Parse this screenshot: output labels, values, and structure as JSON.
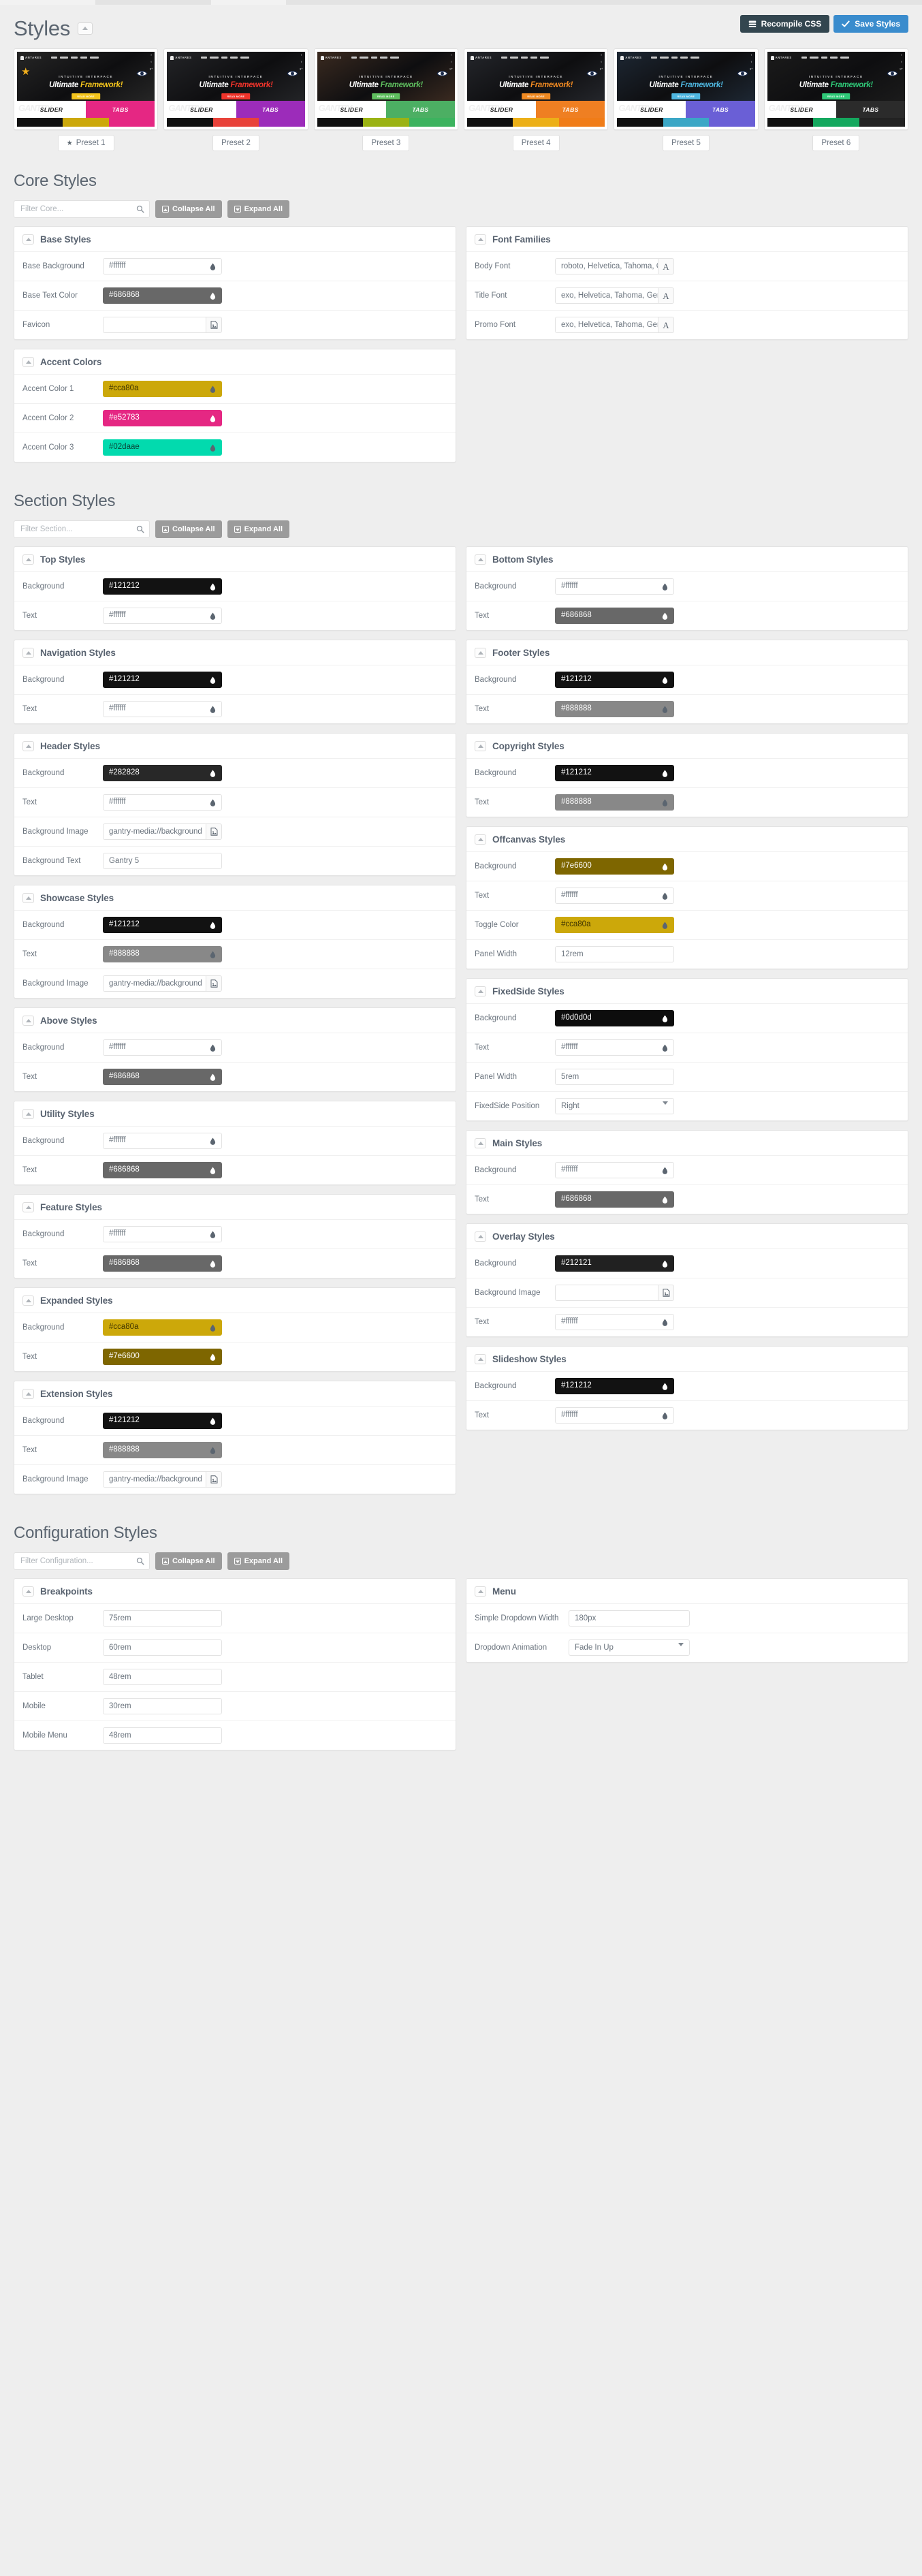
{
  "header": {
    "title": "Styles",
    "collapse_icon": "chevron-up-icon",
    "buttons": [
      {
        "label": "Recompile CSS",
        "icon": "server-icon",
        "color": "#33464f"
      },
      {
        "label": "Save Styles",
        "icon": "check-icon",
        "color": "#3a8ccd"
      }
    ]
  },
  "presets": {
    "thumb_brand": "ANTARES",
    "thumb_nav": [
      "HOME",
      "FEATURES",
      "PAGES",
      "STYLES",
      "DOWNLOAD"
    ],
    "thumb_subtitle": "INTUITIVE INTERFACE",
    "thumb_hero_1": "Ultimate ",
    "thumb_hero_2": "Framework!",
    "thumb_cta": "READ MORE",
    "band_slider": "SLIDER",
    "band_tabs": "TABS",
    "band_ghost": "GANTRY",
    "items": [
      {
        "label": "Preset 1",
        "active": true,
        "accent": "#ddb304",
        "hero_accent": "#f3c41c",
        "tabs_bg": "#e52783",
        "hero_bg": "#262626",
        "swatches": [
          "#111111",
          "#cca80a",
          "#e52783"
        ],
        "eye_icon": "eye-icon",
        "star_icon": "star-icon"
      },
      {
        "label": "Preset 2",
        "active": false,
        "accent": "#e8423a",
        "hero_accent": "#f0342b",
        "tabs_bg": "#9c2cba",
        "hero_bg": "#232427",
        "swatches": [
          "#111111",
          "#e8423a",
          "#9c2cba"
        ],
        "eye_icon": "eye-icon"
      },
      {
        "label": "Preset 3",
        "active": false,
        "accent": "#6fb650",
        "hero_accent": "#5fbf5f",
        "tabs_bg": "#4caf63",
        "hero_bg": "#3a2a20",
        "swatches": [
          "#111111",
          "#9bb313",
          "#3cb35e"
        ],
        "eye_icon": "eye-icon"
      },
      {
        "label": "Preset 4",
        "active": false,
        "accent": "#ef7f22",
        "hero_accent": "#f08a22",
        "tabs_bg": "#ef7f22",
        "hero_bg": "#24262b",
        "swatches": [
          "#111111",
          "#ecb018",
          "#f07c18"
        ],
        "eye_icon": "eye-icon"
      },
      {
        "label": "Preset 5",
        "active": false,
        "accent": "#47a9d0",
        "hero_accent": "#4fb7e0",
        "tabs_bg": "#6a5fd6",
        "hero_bg": "#1d2733",
        "swatches": [
          "#111111",
          "#3ba7c6",
          "#6a5fd6"
        ],
        "eye_icon": "eye-icon"
      },
      {
        "label": "Preset 6",
        "active": false,
        "accent": "#27b36a",
        "hero_accent": "#2fc978",
        "tabs_bg": "#2b2b2b",
        "hero_bg": "#1b1b1b",
        "swatches": [
          "#111111",
          "#14a85e",
          "#222222"
        ],
        "eye_icon": "eye-icon"
      }
    ]
  },
  "core": {
    "title": "Core Styles",
    "filter_placeholder": "Filter Core...",
    "collapse_all": "Collapse All",
    "expand_all": "Expand All",
    "panels_left": [
      {
        "title": "Base Styles",
        "fields": [
          {
            "label": "Base Background",
            "type": "color",
            "value": "#ffffff",
            "bg": "#ffffff",
            "fg": "#6b747e",
            "drop": "#5b6570"
          },
          {
            "label": "Base Text Color",
            "type": "color",
            "value": "#686868",
            "bg": "#686868",
            "fg": "#ffffff",
            "drop": "#ffffff"
          },
          {
            "label": "Favicon",
            "type": "file",
            "value": "",
            "btn_icon": "image-icon"
          }
        ]
      },
      {
        "title": "Accent Colors",
        "fields": [
          {
            "label": "Accent Color 1",
            "type": "color",
            "value": "#cca80a",
            "bg": "#cca80a",
            "fg": "#3d3300",
            "drop": "#5b6570"
          },
          {
            "label": "Accent Color 2",
            "type": "color",
            "value": "#e52783",
            "bg": "#e52783",
            "fg": "#ffffff",
            "drop": "#ffffff"
          },
          {
            "label": "Accent Color 3",
            "type": "color",
            "value": "#02daae",
            "bg": "#02daae",
            "fg": "#0b4437",
            "drop": "#5b6570"
          }
        ]
      }
    ],
    "panels_right": [
      {
        "title": "Font Families",
        "fields": [
          {
            "label": "Body Font",
            "type": "font",
            "value": "roboto, Helvetica, Tahoma, Geneva, Arial, sans-serif",
            "btn_icon": "font-icon"
          },
          {
            "label": "Title Font",
            "type": "font",
            "value": "exo, Helvetica, Tahoma, Geneva, Arial, sans-serif",
            "btn_icon": "font-icon"
          },
          {
            "label": "Promo Font",
            "type": "font",
            "value": "exo, Helvetica, Tahoma, Geneva, Arial, sans-serif",
            "btn_icon": "font-icon"
          }
        ]
      }
    ]
  },
  "section": {
    "title": "Section Styles",
    "filter_placeholder": "Filter Section...",
    "collapse_all": "Collapse All",
    "expand_all": "Expand All",
    "panels_left": [
      {
        "title": "Top Styles",
        "fields": [
          {
            "label": "Background",
            "type": "color",
            "value": "#121212",
            "bg": "#121212",
            "fg": "#ffffff",
            "drop": "#ffffff"
          },
          {
            "label": "Text",
            "type": "color",
            "value": "#ffffff",
            "bg": "#ffffff",
            "fg": "#6b747e",
            "drop": "#5b6570"
          }
        ]
      },
      {
        "title": "Navigation Styles",
        "fields": [
          {
            "label": "Background",
            "type": "color",
            "value": "#121212",
            "bg": "#121212",
            "fg": "#ffffff",
            "drop": "#ffffff"
          },
          {
            "label": "Text",
            "type": "color",
            "value": "#ffffff",
            "bg": "#ffffff",
            "fg": "#6b747e",
            "drop": "#5b6570"
          }
        ]
      },
      {
        "title": "Header Styles",
        "fields": [
          {
            "label": "Background",
            "type": "color",
            "value": "#282828",
            "bg": "#282828",
            "fg": "#ffffff",
            "drop": "#ffffff"
          },
          {
            "label": "Text",
            "type": "color",
            "value": "#ffffff",
            "bg": "#ffffff",
            "fg": "#6b747e",
            "drop": "#5b6570"
          },
          {
            "label": "Background Image",
            "type": "file",
            "value": "gantry-media://background",
            "btn_icon": "image-icon"
          },
          {
            "label": "Background Text",
            "type": "text",
            "value": "Gantry 5"
          }
        ]
      },
      {
        "title": "Showcase Styles",
        "fields": [
          {
            "label": "Background",
            "type": "color",
            "value": "#121212",
            "bg": "#121212",
            "fg": "#ffffff",
            "drop": "#ffffff"
          },
          {
            "label": "Text",
            "type": "color",
            "value": "#888888",
            "bg": "#888888",
            "fg": "#ffffff",
            "drop": "#5b6570"
          },
          {
            "label": "Background Image",
            "type": "file",
            "value": "gantry-media://background",
            "btn_icon": "image-icon"
          }
        ]
      },
      {
        "title": "Above Styles",
        "fields": [
          {
            "label": "Background",
            "type": "color",
            "value": "#ffffff",
            "bg": "#ffffff",
            "fg": "#6b747e",
            "drop": "#5b6570"
          },
          {
            "label": "Text",
            "type": "color",
            "value": "#686868",
            "bg": "#686868",
            "fg": "#ffffff",
            "drop": "#ffffff"
          }
        ]
      },
      {
        "title": "Utility Styles",
        "fields": [
          {
            "label": "Background",
            "type": "color",
            "value": "#ffffff",
            "bg": "#ffffff",
            "fg": "#6b747e",
            "drop": "#5b6570"
          },
          {
            "label": "Text",
            "type": "color",
            "value": "#686868",
            "bg": "#686868",
            "fg": "#ffffff",
            "drop": "#ffffff"
          }
        ]
      },
      {
        "title": "Feature Styles",
        "fields": [
          {
            "label": "Background",
            "type": "color",
            "value": "#ffffff",
            "bg": "#ffffff",
            "fg": "#6b747e",
            "drop": "#5b6570"
          },
          {
            "label": "Text",
            "type": "color",
            "value": "#686868",
            "bg": "#686868",
            "fg": "#ffffff",
            "drop": "#ffffff"
          }
        ]
      },
      {
        "title": "Expanded Styles",
        "fields": [
          {
            "label": "Background",
            "type": "color",
            "value": "#cca80a",
            "bg": "#cca80a",
            "fg": "#3d3300",
            "drop": "#5b6570"
          },
          {
            "label": "Text",
            "type": "color",
            "value": "#7e6600",
            "bg": "#7e6600",
            "fg": "#ffffff",
            "drop": "#ffffff"
          }
        ]
      },
      {
        "title": "Extension Styles",
        "fields": [
          {
            "label": "Background",
            "type": "color",
            "value": "#121212",
            "bg": "#121212",
            "fg": "#ffffff",
            "drop": "#ffffff"
          },
          {
            "label": "Text",
            "type": "color",
            "value": "#888888",
            "bg": "#888888",
            "fg": "#ffffff",
            "drop": "#5b6570"
          },
          {
            "label": "Background Image",
            "type": "file",
            "value": "gantry-media://background",
            "btn_icon": "image-icon"
          }
        ]
      }
    ],
    "panels_right": [
      {
        "title": "Bottom Styles",
        "fields": [
          {
            "label": "Background",
            "type": "color",
            "value": "#ffffff",
            "bg": "#ffffff",
            "fg": "#6b747e",
            "drop": "#5b6570"
          },
          {
            "label": "Text",
            "type": "color",
            "value": "#686868",
            "bg": "#686868",
            "fg": "#ffffff",
            "drop": "#ffffff"
          }
        ]
      },
      {
        "title": "Footer Styles",
        "fields": [
          {
            "label": "Background",
            "type": "color",
            "value": "#121212",
            "bg": "#121212",
            "fg": "#ffffff",
            "drop": "#ffffff"
          },
          {
            "label": "Text",
            "type": "color",
            "value": "#888888",
            "bg": "#888888",
            "fg": "#ffffff",
            "drop": "#5b6570"
          }
        ]
      },
      {
        "title": "Copyright Styles",
        "fields": [
          {
            "label": "Background",
            "type": "color",
            "value": "#121212",
            "bg": "#121212",
            "fg": "#ffffff",
            "drop": "#ffffff"
          },
          {
            "label": "Text",
            "type": "color",
            "value": "#888888",
            "bg": "#888888",
            "fg": "#ffffff",
            "drop": "#5b6570"
          }
        ]
      },
      {
        "title": "Offcanvas Styles",
        "fields": [
          {
            "label": "Background",
            "type": "color",
            "value": "#7e6600",
            "bg": "#7e6600",
            "fg": "#ffffff",
            "drop": "#ffffff"
          },
          {
            "label": "Text",
            "type": "color",
            "value": "#ffffff",
            "bg": "#ffffff",
            "fg": "#6b747e",
            "drop": "#5b6570"
          },
          {
            "label": "Toggle Color",
            "type": "color",
            "value": "#cca80a",
            "bg": "#cca80a",
            "fg": "#3d3300",
            "drop": "#5b6570"
          },
          {
            "label": "Panel Width",
            "type": "text",
            "value": "12rem"
          }
        ]
      },
      {
        "title": "FixedSide Styles",
        "fields": [
          {
            "label": "Background",
            "type": "color",
            "value": "#0d0d0d",
            "bg": "#0d0d0d",
            "fg": "#ffffff",
            "drop": "#ffffff"
          },
          {
            "label": "Text",
            "type": "color",
            "value": "#ffffff",
            "bg": "#ffffff",
            "fg": "#6b747e",
            "drop": "#5b6570"
          },
          {
            "label": "Panel Width",
            "type": "text",
            "value": "5rem"
          },
          {
            "label": "FixedSide Position",
            "type": "select",
            "value": "Right"
          }
        ]
      },
      {
        "title": "Main Styles",
        "fields": [
          {
            "label": "Background",
            "type": "color",
            "value": "#ffffff",
            "bg": "#ffffff",
            "fg": "#6b747e",
            "drop": "#5b6570"
          },
          {
            "label": "Text",
            "type": "color",
            "value": "#686868",
            "bg": "#686868",
            "fg": "#ffffff",
            "drop": "#ffffff"
          }
        ]
      },
      {
        "title": "Overlay Styles",
        "fields": [
          {
            "label": "Background",
            "type": "color",
            "value": "#212121",
            "bg": "#212121",
            "fg": "#ffffff",
            "drop": "#ffffff"
          },
          {
            "label": "Background Image",
            "type": "file",
            "value": "",
            "btn_icon": "image-icon"
          },
          {
            "label": "Text",
            "type": "color",
            "value": "#ffffff",
            "bg": "#ffffff",
            "fg": "#6b747e",
            "drop": "#5b6570"
          }
        ]
      },
      {
        "title": "Slideshow Styles",
        "fields": [
          {
            "label": "Background",
            "type": "color",
            "value": "#121212",
            "bg": "#121212",
            "fg": "#ffffff",
            "drop": "#ffffff"
          },
          {
            "label": "Text",
            "type": "color",
            "value": "#ffffff",
            "bg": "#ffffff",
            "fg": "#6b747e",
            "drop": "#5b6570"
          }
        ]
      }
    ]
  },
  "configuration": {
    "title": "Configuration Styles",
    "filter_placeholder": "Filter Configuration...",
    "collapse_all": "Collapse All",
    "expand_all": "Expand All",
    "panels_left": [
      {
        "title": "Breakpoints",
        "fields": [
          {
            "label": "Large Desktop",
            "type": "text",
            "value": "75rem"
          },
          {
            "label": "Desktop",
            "type": "text",
            "value": "60rem"
          },
          {
            "label": "Tablet",
            "type": "text",
            "value": "48rem"
          },
          {
            "label": "Mobile",
            "type": "text",
            "value": "30rem"
          },
          {
            "label": "Mobile Menu",
            "type": "text",
            "value": "48rem"
          }
        ]
      }
    ],
    "panels_right": [
      {
        "title": "Menu",
        "fields": [
          {
            "label": "Simple Dropdown Width",
            "type": "text",
            "value": "180px",
            "wide": true
          },
          {
            "label": "Dropdown Animation",
            "type": "select",
            "value": "Fade In Up",
            "wide": true
          }
        ]
      }
    ]
  }
}
